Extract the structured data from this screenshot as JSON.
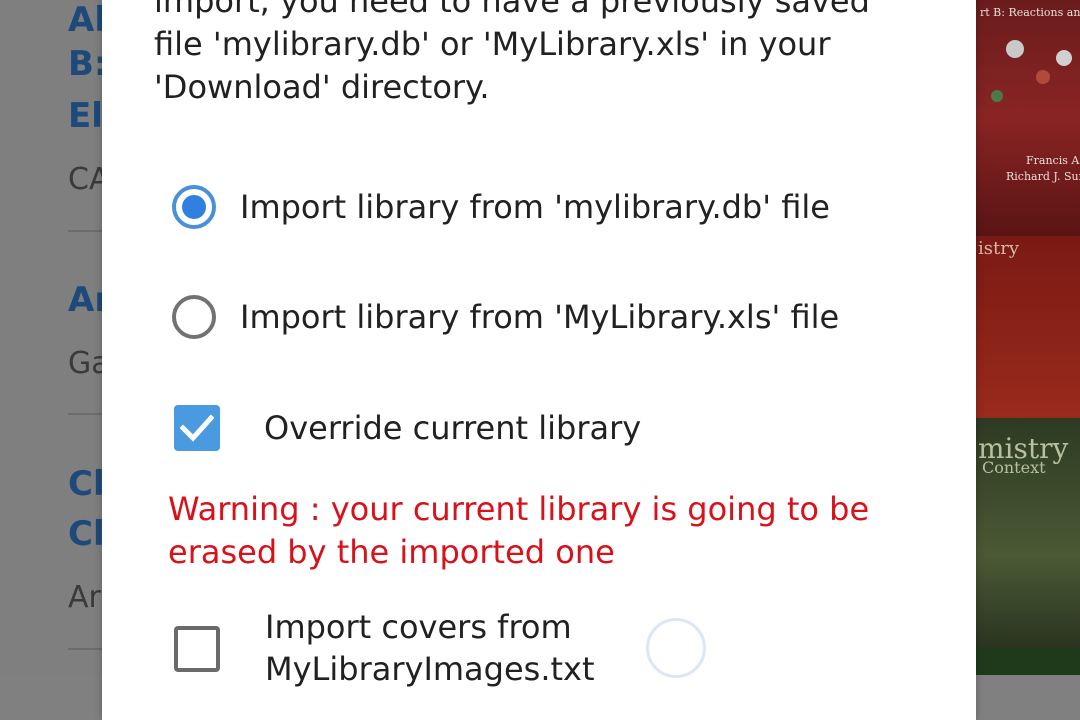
{
  "background_list": {
    "items": [
      {
        "title_lines": [
          "Al",
          "B:",
          "El"
        ],
        "subtitle": "CA"
      },
      {
        "title_lines": [
          "Ar"
        ],
        "subtitle": "Ga"
      },
      {
        "title_lines": [
          "Cl",
          "Cl"
        ],
        "subtitle": "Ar"
      }
    ]
  },
  "background_covers": {
    "cover1_title": "rt B: Reactions and Synth",
    "cover1_authors": [
      "Francis A. C",
      "Richard J. Sund"
    ],
    "cover2_title": "istry",
    "cover3_title": "mistry",
    "cover3_subtitle": "Context"
  },
  "dialog": {
    "intro_text": "import, you need to have a previously saved file 'mylibrary.db' or 'MyLibrary.xls' in your 'Download' directory.",
    "radio_db_label": "Import library from 'mylibrary.db' file",
    "radio_db_selected": true,
    "radio_xls_label": "Import library from 'MyLibrary.xls' file",
    "radio_xls_selected": false,
    "override_label": "Override current library",
    "override_checked": true,
    "warning_text": "Warning : your current library is going to be erased by the imported one",
    "import_covers_label": "Import covers from MyLibraryImages.txt",
    "import_covers_checked": false
  },
  "colors": {
    "accent": "#2f80e0",
    "warning": "#d8111a",
    "title_blue": "#1d4a7a"
  }
}
